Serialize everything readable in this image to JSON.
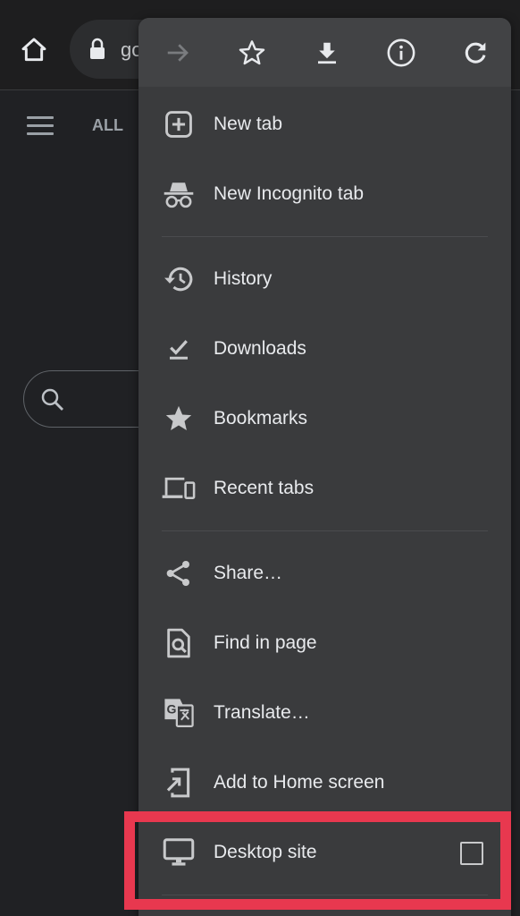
{
  "topbar": {
    "omnibox_text": "go",
    "home_icon": "home-icon",
    "lock_icon": "lock-icon"
  },
  "page": {
    "tab_all": "ALL",
    "menu_icon": "hamburger-icon",
    "search_icon": "search-icon"
  },
  "menu": {
    "toolbar": [
      {
        "name": "forward",
        "icon": "arrow-right-icon",
        "enabled": false
      },
      {
        "name": "bookmark",
        "icon": "star-outline-icon",
        "enabled": true
      },
      {
        "name": "download",
        "icon": "download-icon",
        "enabled": true
      },
      {
        "name": "page-info",
        "icon": "info-icon",
        "enabled": true
      },
      {
        "name": "reload",
        "icon": "refresh-icon",
        "enabled": true
      }
    ],
    "items": [
      {
        "label": "New tab",
        "icon": "plus-box-icon"
      },
      {
        "label": "New Incognito tab",
        "icon": "incognito-icon"
      },
      {
        "label": "History",
        "icon": "history-icon"
      },
      {
        "label": "Downloads",
        "icon": "download-done-icon"
      },
      {
        "label": "Bookmarks",
        "icon": "star-icon"
      },
      {
        "label": "Recent tabs",
        "icon": "devices-icon"
      },
      {
        "label": "Share…",
        "icon": "share-icon"
      },
      {
        "label": "Find in page",
        "icon": "find-in-page-icon"
      },
      {
        "label": "Translate…",
        "icon": "translate-icon"
      },
      {
        "label": "Add to Home screen",
        "icon": "add-to-home-icon"
      },
      {
        "label": "Desktop site",
        "icon": "monitor-icon",
        "checkbox": true,
        "checked": false
      }
    ]
  },
  "colors": {
    "highlight": "#e8384f",
    "menu_bg": "#3a3b3d",
    "toolbar_bg": "#424345",
    "page_bg": "#202124"
  }
}
